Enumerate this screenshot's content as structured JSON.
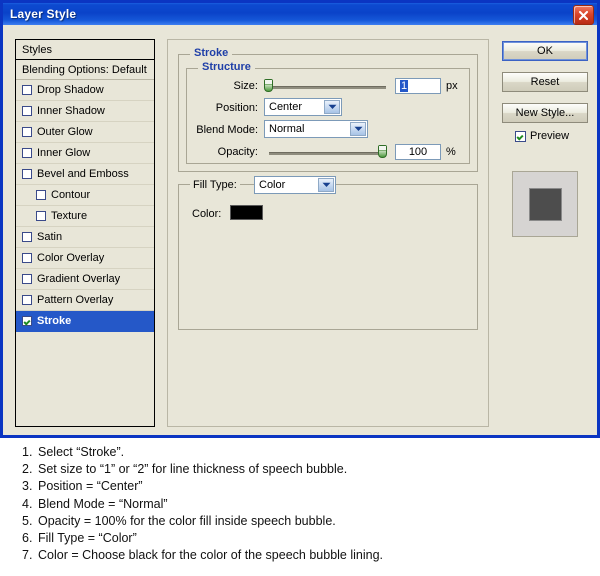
{
  "window": {
    "title": "Layer Style",
    "close_icon": "close-icon"
  },
  "styles_panel": {
    "header": "Styles",
    "blending_options": "Blending Options: Default",
    "items": [
      {
        "label": "Drop Shadow",
        "checked": false,
        "indent": false,
        "selected": false
      },
      {
        "label": "Inner Shadow",
        "checked": false,
        "indent": false,
        "selected": false
      },
      {
        "label": "Outer Glow",
        "checked": false,
        "indent": false,
        "selected": false
      },
      {
        "label": "Inner Glow",
        "checked": false,
        "indent": false,
        "selected": false
      },
      {
        "label": "Bevel and Emboss",
        "checked": false,
        "indent": false,
        "selected": false
      },
      {
        "label": "Contour",
        "checked": false,
        "indent": true,
        "selected": false
      },
      {
        "label": "Texture",
        "checked": false,
        "indent": true,
        "selected": false
      },
      {
        "label": "Satin",
        "checked": false,
        "indent": false,
        "selected": false
      },
      {
        "label": "Color Overlay",
        "checked": false,
        "indent": false,
        "selected": false
      },
      {
        "label": "Gradient Overlay",
        "checked": false,
        "indent": false,
        "selected": false
      },
      {
        "label": "Pattern Overlay",
        "checked": false,
        "indent": false,
        "selected": false
      },
      {
        "label": "Stroke",
        "checked": true,
        "indent": false,
        "selected": true
      }
    ]
  },
  "stroke_panel": {
    "group_title": "Stroke",
    "structure": {
      "group_title": "Structure",
      "size_label": "Size:",
      "size_value": "1",
      "size_unit": "px",
      "size_slider_percent": 2,
      "position_label": "Position:",
      "position_value": "Center",
      "blend_mode_label": "Blend Mode:",
      "blend_mode_value": "Normal",
      "opacity_label": "Opacity:",
      "opacity_value": "100",
      "opacity_unit": "%",
      "opacity_slider_percent": 100
    },
    "fill": {
      "fill_type_label": "Fill Type:",
      "fill_type_value": "Color",
      "color_label": "Color:",
      "color_value": "#000000"
    }
  },
  "buttons": {
    "ok": "OK",
    "reset": "Reset",
    "new_style": "New Style...",
    "preview_label": "Preview",
    "preview_checked": true
  },
  "instructions": [
    {
      "num": "1.",
      "text": "Select “Stroke”."
    },
    {
      "num": "2.",
      "text": "Set size to “1” or “2” for line thickness of speech bubble."
    },
    {
      "num": "3.",
      "text": "Position = “Center”"
    },
    {
      "num": "4.",
      "text": "Blend Mode = “Normal”"
    },
    {
      "num": "5.",
      "text": "Opacity = 100% for the color fill inside speech bubble."
    },
    {
      "num": "6.",
      "text": "Fill Type = “Color”"
    },
    {
      "num": "7.",
      "text": "Color = Choose black for the color of the speech bubble lining."
    }
  ],
  "colors": {
    "titlebar_blue": "#0a43c9",
    "dialog_face": "#e8e6d8",
    "selection_blue": "#2558c8",
    "group_title_blue": "#1f3fa8",
    "close_red": "#d9452a",
    "stroke_color": "#000000",
    "preview_square": "#4d4d4d"
  }
}
